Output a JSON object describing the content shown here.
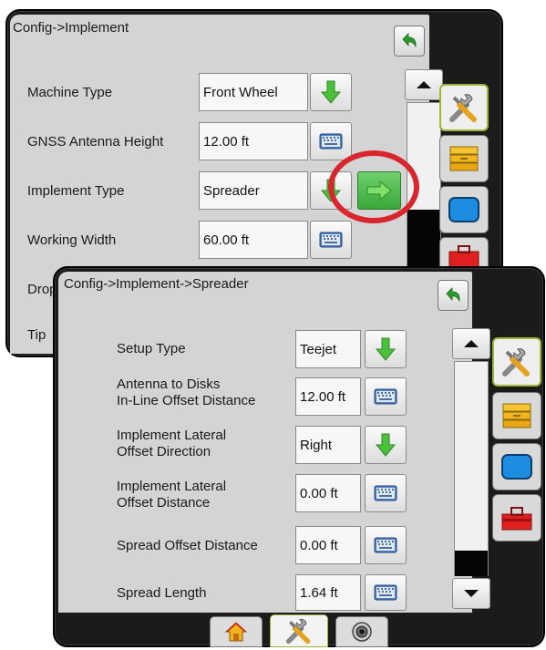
{
  "back_screen": {
    "title": "Config->Implement",
    "rows": [
      {
        "label": "Machine Type",
        "value": "Front Wheel",
        "control": "dropdown"
      },
      {
        "label": "GNSS Antenna Height",
        "value": "12.00 ft",
        "control": "keyboard"
      },
      {
        "label": "Implement Type",
        "value": "Spreader",
        "control": "dropdown"
      },
      {
        "label": "Working Width",
        "value": "60.00 ft",
        "control": "keyboard"
      },
      {
        "label": "Drop",
        "value": "",
        "control": "keyboard"
      },
      {
        "label": "Tip",
        "value": "",
        "control": "none"
      }
    ],
    "highlight_color": "#d9262e"
  },
  "front_screen": {
    "title": "Config->Implement->Spreader",
    "rows": [
      {
        "label": "Setup Type",
        "value": "Teejet",
        "control": "dropdown"
      },
      {
        "label_line1": "Antenna to Disks",
        "label_line2": "In-Line Offset Distance",
        "value": "12.00 ft",
        "control": "keyboard"
      },
      {
        "label_line1": "Implement Lateral",
        "label_line2": "Offset Direction",
        "value": "Right",
        "control": "dropdown"
      },
      {
        "label_line1": "Implement Lateral",
        "label_line2": "Offset Distance",
        "value": "0.00 ft",
        "control": "keyboard"
      },
      {
        "label": "Spread Offset Distance",
        "value": "0.00 ft",
        "control": "keyboard"
      },
      {
        "label": "Spread Length",
        "value": "1.64 ft",
        "control": "keyboard"
      }
    ],
    "bottom_tabs": [
      "home-icon",
      "tools-icon",
      "camera-icon"
    ],
    "active_bottom_tab": "tools-icon"
  },
  "side_tabs": [
    "tools-icon",
    "data-icon",
    "screen-icon",
    "toolbox-icon"
  ],
  "active_side_tab": "tools-icon",
  "colors": {
    "accent_green": "#3aa63a",
    "active_border": "#9ab53a",
    "panel": "#d4d4d4"
  }
}
